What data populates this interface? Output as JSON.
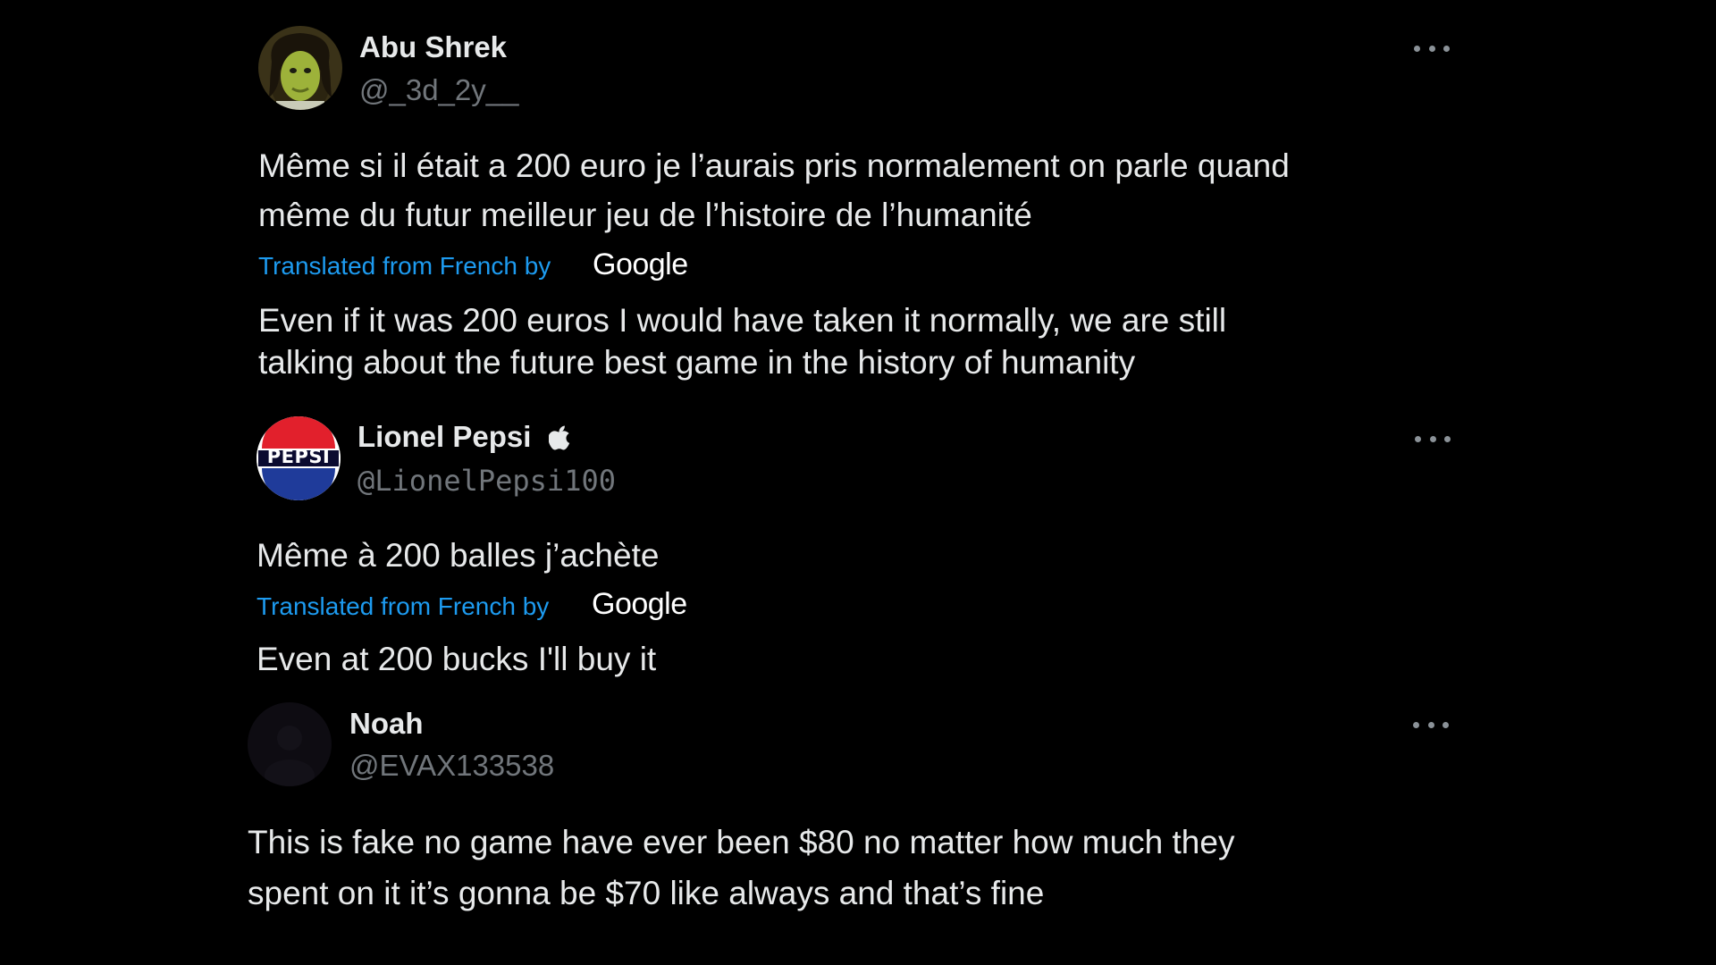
{
  "tweets": [
    {
      "display_name": "Abu Shrek",
      "handle": "@_3d_2y__",
      "text_lines": [
        "Même si il était a 200 euro je l’aurais pris normalement on parle quand",
        "même du futur meilleur jeu de l’histoire de l’humanité"
      ],
      "translated_label": "Translated from French by",
      "translator": "Google",
      "translation_lines": [
        "Even if it was 200 euros I would have taken it normally, we are still",
        "talking about the future best game in the history of humanity"
      ],
      "avatar_icon": "shrek-avatar"
    },
    {
      "display_name": "Lionel Pepsi",
      "handle": "@LionelPepsi100",
      "badge_icon": "apple-icon",
      "avatar_icon": "pepsi-logo-avatar",
      "avatar_text": "PEPSI",
      "text_lines": [
        "Même à 200 balles j’achète"
      ],
      "translated_label": "Translated from French by",
      "translator": "Google",
      "translation_lines": [
        "Even at 200 bucks I'll buy it"
      ]
    },
    {
      "display_name": "Noah",
      "handle": "@EVAX133538",
      "avatar_icon": "dark-avatar",
      "text_lines": [
        "This is fake no game have ever been $80 no matter how much they",
        "spent on it it’s gonna be $70 like always and that’s fine"
      ]
    }
  ],
  "colors": {
    "background": "#000000",
    "text": "#e7e9ea",
    "handle": "#71767b",
    "link": "#1d9bf0"
  }
}
